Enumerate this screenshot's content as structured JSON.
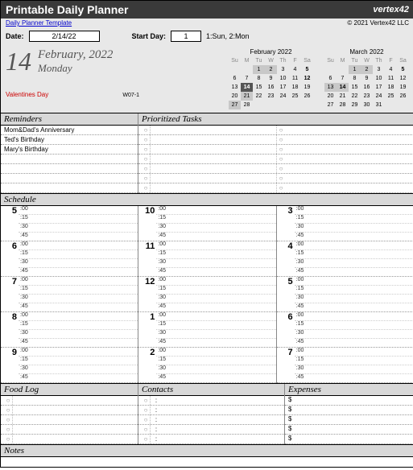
{
  "header": {
    "title": "Printable Daily Planner",
    "brand": "vertex42",
    "link": "Daily Planner Template",
    "copyright": "© 2021 Vertex42 LLC"
  },
  "controls": {
    "date_label": "Date:",
    "date_value": "2/14/22",
    "startday_label": "Start Day:",
    "startday_value": "1",
    "startday_hint": "1:Sun, 2:Mon"
  },
  "dateinfo": {
    "daynum": "14",
    "month": "February, 2022",
    "weekday": "Monday",
    "special": "Valentines Day",
    "week": "W07-1"
  },
  "cal1": {
    "title": "February 2022",
    "dow": [
      "Su",
      "M",
      "Tu",
      "W",
      "Th",
      "F",
      "Sa"
    ],
    "rows": [
      [
        "",
        "",
        "1",
        "2",
        "3",
        "4",
        "5"
      ],
      [
        "6",
        "7",
        "8",
        "9",
        "10",
        "11",
        "12"
      ],
      [
        "13",
        "14",
        "15",
        "16",
        "17",
        "18",
        "19"
      ],
      [
        "20",
        "21",
        "22",
        "23",
        "24",
        "25",
        "26"
      ],
      [
        "27",
        "28",
        "",
        "",
        "",
        "",
        ""
      ]
    ],
    "hl": [
      "1",
      "2",
      "14",
      "21",
      "27"
    ],
    "today": "14",
    "bold": [
      "5",
      "12",
      "14"
    ]
  },
  "cal2": {
    "title": "March 2022",
    "dow": [
      "Su",
      "M",
      "Tu",
      "W",
      "Th",
      "F",
      "Sa"
    ],
    "rows": [
      [
        "",
        "",
        "1",
        "2",
        "3",
        "4",
        "5"
      ],
      [
        "6",
        "7",
        "8",
        "9",
        "10",
        "11",
        "12"
      ],
      [
        "13",
        "14",
        "15",
        "16",
        "17",
        "18",
        "19"
      ],
      [
        "20",
        "21",
        "22",
        "23",
        "24",
        "25",
        "26"
      ],
      [
        "27",
        "28",
        "29",
        "30",
        "31",
        "",
        ""
      ]
    ],
    "hl": [
      "1",
      "2",
      "13",
      "14"
    ],
    "bold": [
      "5",
      "14"
    ]
  },
  "sections": {
    "reminders": "Reminders",
    "tasks": "Prioritized Tasks",
    "schedule": "Schedule",
    "foodlog": "Food Log",
    "contacts": "Contacts",
    "expenses": "Expenses",
    "notes": "Notes"
  },
  "reminders": [
    "Mom&Dad's Anniversary",
    "Ted's Birthday",
    "Mary's Birthday",
    "",
    "",
    "",
    ""
  ],
  "tasks": [
    "",
    "",
    "",
    "",
    "",
    "",
    ""
  ],
  "schedule": {
    "mins": [
      ":00",
      ":15",
      ":30",
      ":45"
    ],
    "cols": [
      [
        "5",
        "6",
        "7",
        "8",
        "9"
      ],
      [
        "10",
        "11",
        "12",
        "1",
        "2"
      ],
      [
        "3",
        "4",
        "5",
        "6",
        "7"
      ]
    ]
  },
  "foodlog": [
    "",
    "",
    "",
    "",
    ""
  ],
  "contacts": [
    "",
    "",
    "",
    "",
    ""
  ],
  "expenses": [
    "$",
    "$",
    "$",
    "$",
    "$"
  ]
}
